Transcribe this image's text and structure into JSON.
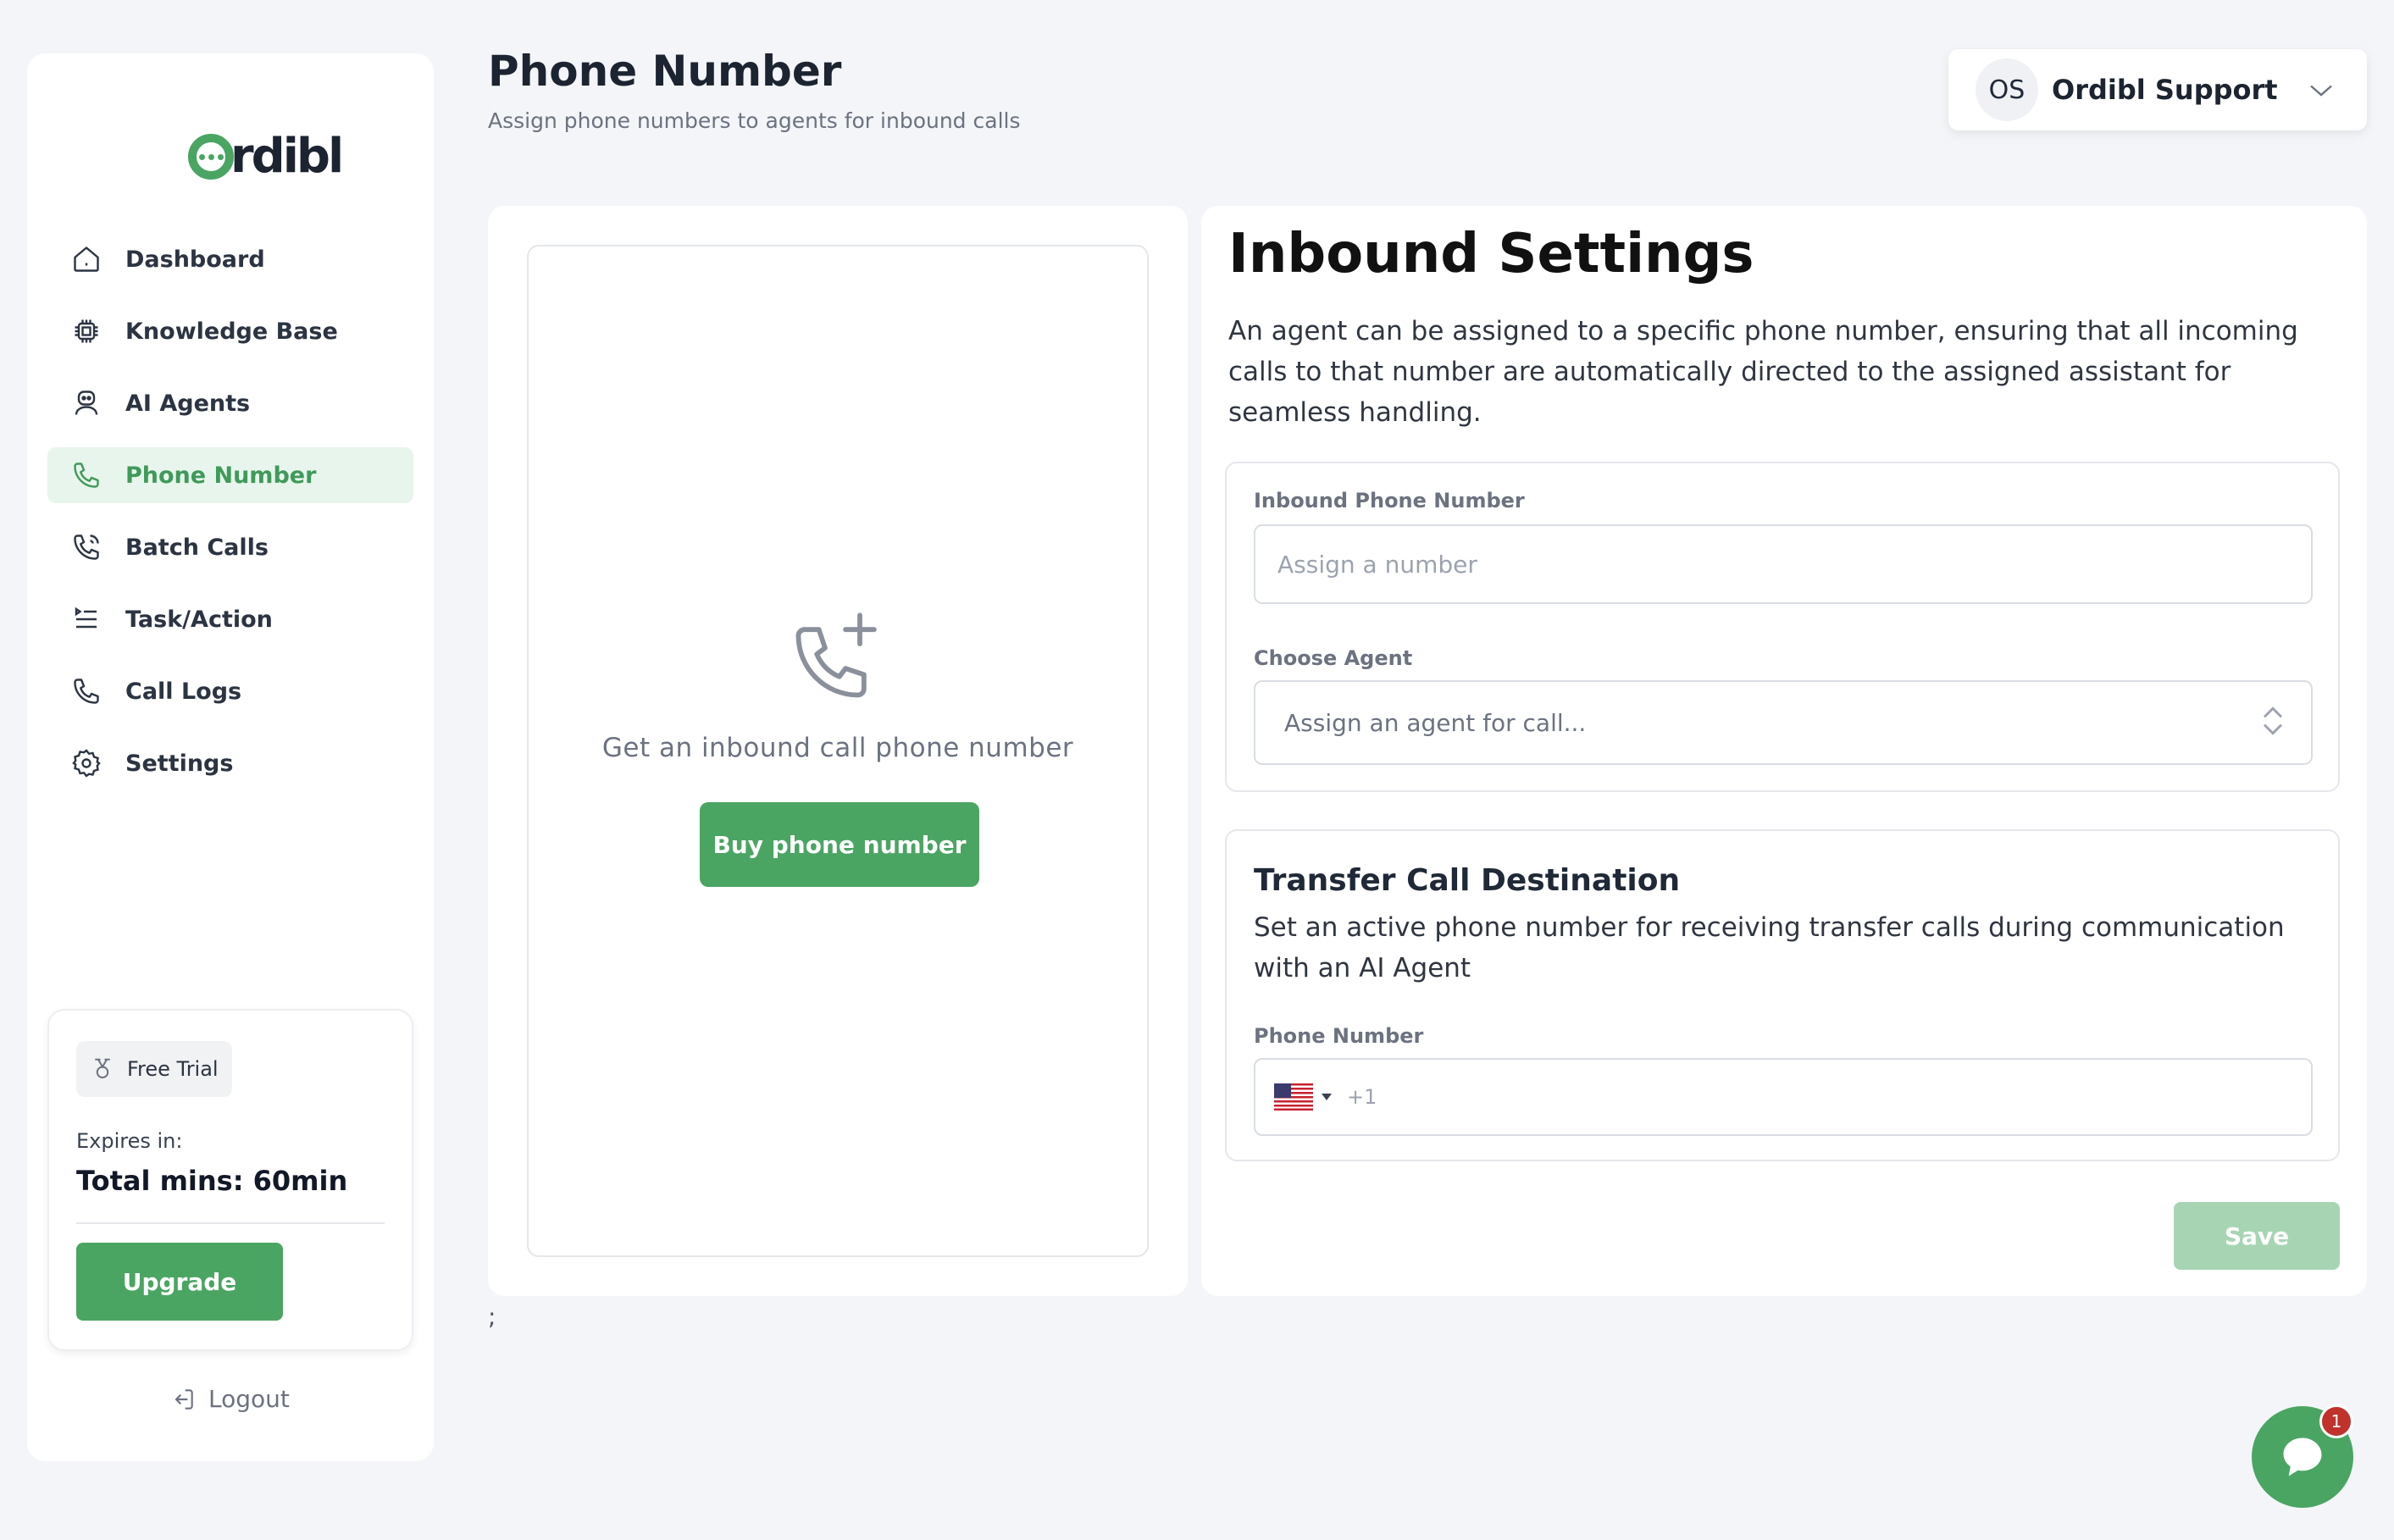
{
  "brand": {
    "name": "rdibl",
    "accent": "#4aa562"
  },
  "sidebar": {
    "items": [
      {
        "label": "Dashboard",
        "icon": "home-icon",
        "active": false
      },
      {
        "label": "Knowledge Base",
        "icon": "chip-icon",
        "active": false
      },
      {
        "label": "AI Agents",
        "icon": "robot-icon",
        "active": false
      },
      {
        "label": "Phone Number",
        "icon": "phone-icon",
        "active": true
      },
      {
        "label": "Batch Calls",
        "icon": "phone-calling-icon",
        "active": false
      },
      {
        "label": "Task/Action",
        "icon": "task-list-icon",
        "active": false
      },
      {
        "label": "Call Logs",
        "icon": "phone-icon",
        "active": false
      },
      {
        "label": "Settings",
        "icon": "gear-icon",
        "active": false
      }
    ],
    "trial": {
      "badge": "Free Trial",
      "expires_label": "Expires in:",
      "total_mins": "Total mins: 60min",
      "upgrade_label": "Upgrade"
    },
    "logout_label": "Logout"
  },
  "header": {
    "title": "Phone Number",
    "subtitle": "Assign phone numbers to agents for inbound calls",
    "user": {
      "initials": "OS",
      "name": "Ordibl Support"
    }
  },
  "left_panel": {
    "empty_text": "Get an inbound call phone number",
    "buy_label": "Buy phone number",
    "stray_text": ";"
  },
  "inbound": {
    "title": "Inbound Settings",
    "description": "An agent can be assigned to a specific phone number, ensuring that all incoming calls to that number are automatically directed to the assigned assistant for seamless handling.",
    "number_label": "Inbound Phone Number",
    "number_placeholder": "Assign a number",
    "agent_label": "Choose Agent",
    "agent_placeholder": "Assign an agent for call..."
  },
  "transfer": {
    "title": "Transfer Call Destination",
    "description": "Set an active phone number for receiving transfer calls during communication with an AI Agent",
    "phone_label": "Phone Number",
    "country_flag": "us-flag-icon",
    "dial_code": "+1",
    "phone_value": ""
  },
  "save_label": "Save",
  "chat": {
    "badge_count": "1"
  }
}
